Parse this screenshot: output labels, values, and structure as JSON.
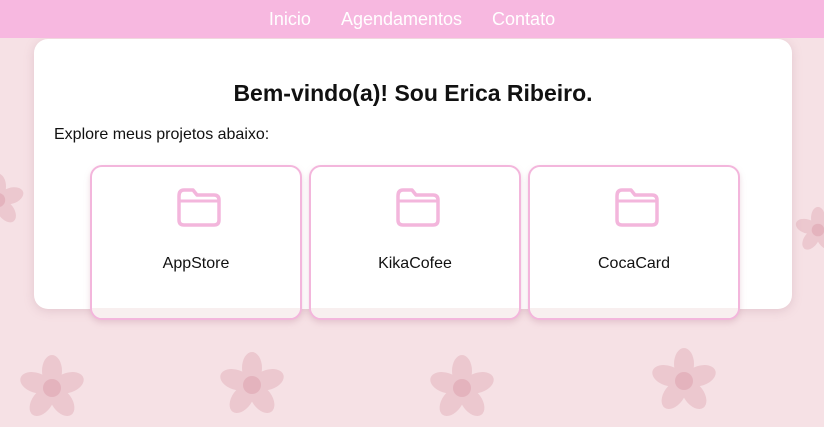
{
  "nav": {
    "items": [
      {
        "label": "Inicio"
      },
      {
        "label": "Agendamentos"
      },
      {
        "label": "Contato"
      }
    ]
  },
  "main": {
    "title": "Bem-vindo(a)! Sou Erica Ribeiro.",
    "subtitle": "Explore meus projetos abaixo:",
    "projects": [
      {
        "label": "AppStore",
        "icon": "folder-icon"
      },
      {
        "label": "KikaCofee",
        "icon": "folder-icon"
      },
      {
        "label": "CocaCard",
        "icon": "folder-icon"
      }
    ]
  },
  "colors": {
    "nav_bg": "#f7b8e0",
    "page_bg": "#f6e1e5",
    "card_border": "#f3b6dc",
    "icon_stroke": "#f3b6dc",
    "flower": "#eccdd3"
  }
}
